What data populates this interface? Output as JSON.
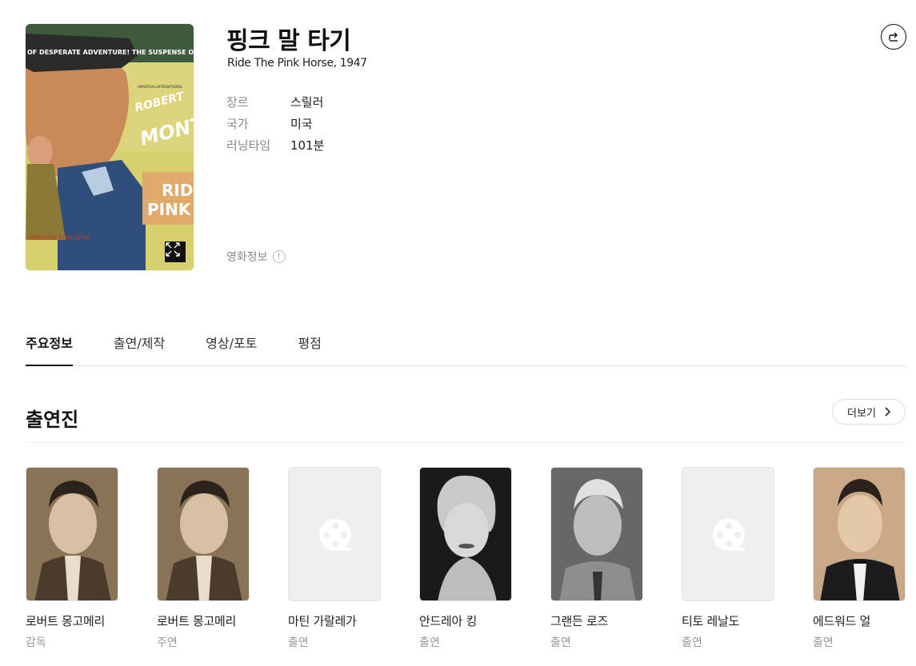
{
  "movie": {
    "title": "핑크 말 타기",
    "subtitle": "Ride The Pink Horse, 1947",
    "info": [
      {
        "key": "장르",
        "value": "스릴러"
      },
      {
        "key": "국가",
        "value": "미국"
      },
      {
        "key": "러닝타임",
        "value": "101분"
      }
    ],
    "info_link": "영화정보",
    "poster_text": {
      "banner": "OF DESPERATE ADVENTURE!  THE SUSPENSE OF RELE",
      "studio": "UNIVERSAL-INTERNATIONAL",
      "star": "ROBERT",
      "star_last": "MONTG",
      "title_line1": "RIDE",
      "title_line2": "PINK H",
      "credit": "Wanda Hendrix"
    }
  },
  "tabs": [
    "주요정보",
    "출연/제작",
    "영상/포토",
    "평점"
  ],
  "active_tab": 0,
  "cast_section": {
    "title": "출연진",
    "more_label": "더보기"
  },
  "cast": [
    {
      "name": "로버트 몽고메리",
      "role": "감독",
      "photo": "photo"
    },
    {
      "name": "로버트 몽고메리",
      "role": "주연",
      "photo": "photo"
    },
    {
      "name": "마틴 가랄레가",
      "role": "출연",
      "photo": "placeholder"
    },
    {
      "name": "안드레아 킹",
      "role": "출연",
      "photo": "photo"
    },
    {
      "name": "그랜든 로즈",
      "role": "출연",
      "photo": "photo"
    },
    {
      "name": "티토 레날도",
      "role": "출연",
      "photo": "placeholder"
    },
    {
      "name": "에드워드 얼",
      "role": "출연",
      "photo": "photo"
    }
  ],
  "icons": {
    "share": "share-icon",
    "expand": "expand-icon",
    "info": "info-icon",
    "chevron": "chevron-right-icon",
    "film_placeholder": "film-reel-icon"
  },
  "colors": {
    "text": "#111111",
    "muted": "#8a8a8a",
    "divider": "#e4e4e4",
    "placeholder_bg": "#efefef"
  }
}
